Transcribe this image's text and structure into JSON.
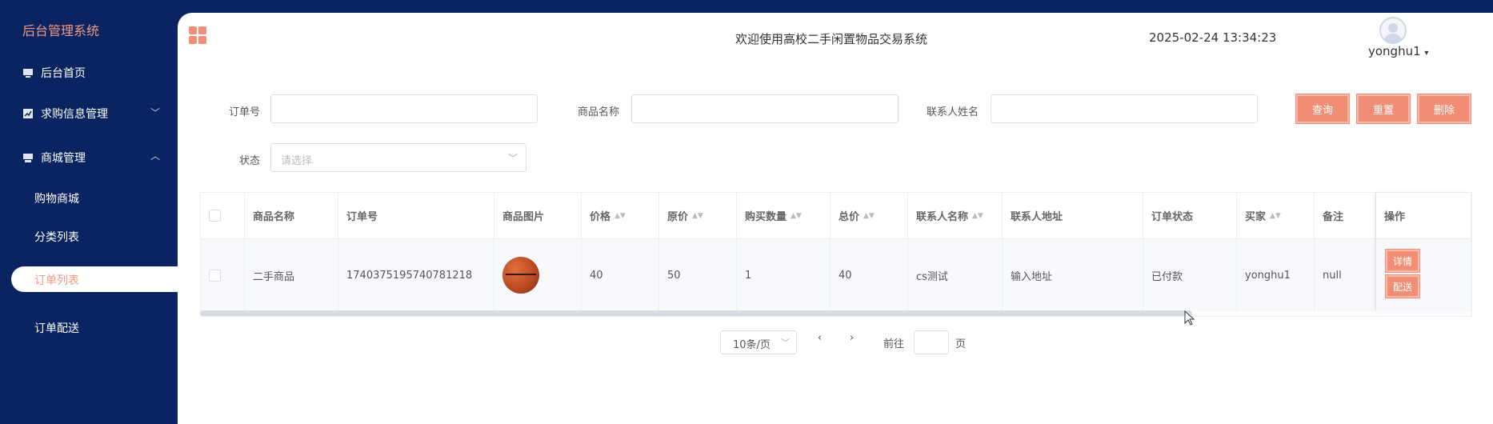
{
  "sidebar": {
    "brand": "后台管理系统",
    "items": [
      {
        "label": "后台首页"
      },
      {
        "label": "求购信息管理"
      },
      {
        "label": "商城管理"
      }
    ],
    "sub_items": [
      {
        "label": "购物商城"
      },
      {
        "label": "分类列表"
      },
      {
        "label": "订单列表"
      },
      {
        "label": "订单配送"
      }
    ]
  },
  "header": {
    "welcome": "欢迎使用高校二手闲置物品交易系统",
    "datetime": "2025-02-24 13:34:23",
    "username": "yonghu1"
  },
  "filters": {
    "order_no_label": "订单号",
    "product_name_label": "商品名称",
    "contact_name_label": "联系人姓名",
    "status_label": "状态",
    "status_placeholder": "请选择",
    "query_button": "查询",
    "reset_button": "重置",
    "delete_button": "删除"
  },
  "table": {
    "headers": [
      "商品名称",
      "订单号",
      "商品图片",
      "价格",
      "原价",
      "购买数量",
      "总价",
      "联系人名称",
      "联系人地址",
      "订单状态",
      "买家",
      "备注",
      "操作"
    ],
    "rows": [
      {
        "product_name": "二手商品",
        "order_no": "1740375195740781218",
        "price": "40",
        "original_price": "50",
        "quantity": "1",
        "total": "40",
        "contact_name": "cs测试",
        "contact_address": "输入地址",
        "status": "已付款",
        "buyer": "yonghu1",
        "remark": "null",
        "detail_button": "详情",
        "ship_button": "配送"
      }
    ]
  },
  "pagination": {
    "page_size": "10条/页",
    "prev": "‹",
    "next": "›",
    "goto_label": "前往",
    "page_suffix": "页"
  },
  "colors": {
    "sidebar_bg": "#0a2461",
    "accent": "#f28e76",
    "brand_text": "#f39a82"
  }
}
